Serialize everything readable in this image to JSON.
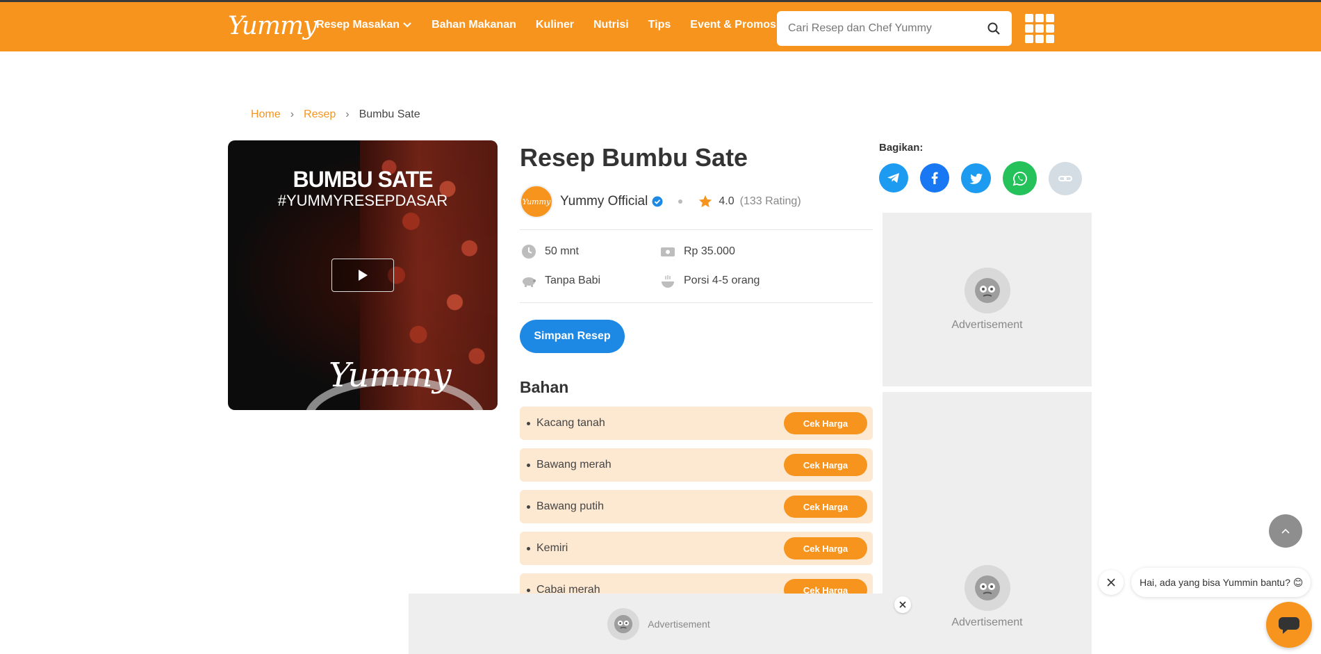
{
  "header": {
    "logo_text": "Yummy",
    "nav": [
      {
        "label": "Resep Masakan",
        "has_dropdown": true
      },
      {
        "label": "Bahan Makanan"
      },
      {
        "label": "Kuliner"
      },
      {
        "label": "Nutrisi"
      },
      {
        "label": "Tips"
      },
      {
        "label": "Event & Promosi"
      }
    ],
    "search_placeholder": "Cari Resep dan Chef Yummy",
    "brand_color": "#f7941e"
  },
  "breadcrumb": {
    "home": "Home",
    "sep": "›",
    "resep": "Resep",
    "current": "Bumbu Sate"
  },
  "video": {
    "title": "BUMBU SATE",
    "hashtag": "#YUMMYRESEPDASAR",
    "watermark": "Yummy"
  },
  "recipe": {
    "title": "Resep Bumbu Sate",
    "author": "Yummy Official",
    "avatar_text": "Yummy",
    "rating": "4.0",
    "rating_count": "(133 Rating)",
    "time": "50 mnt",
    "price": "Rp 35.000",
    "halal": "Tanpa Babi",
    "portion": "Porsi 4-5 orang",
    "save_label": "Simpan Resep"
  },
  "bahan": {
    "heading": "Bahan",
    "button_label": "Cek Harga",
    "items": [
      "Kacang tanah",
      "Bawang merah",
      "Bawang putih",
      "Kemiri",
      "Cabai merah"
    ]
  },
  "share": {
    "label": "Bagikan:",
    "icons": [
      "telegram-icon",
      "facebook-icon",
      "twitter-icon",
      "whatsapp-icon",
      "link-icon"
    ]
  },
  "ads": {
    "label": "Advertisement"
  },
  "chat": {
    "message": "Hai, ada yang bisa Yummin bantu? 😊"
  }
}
